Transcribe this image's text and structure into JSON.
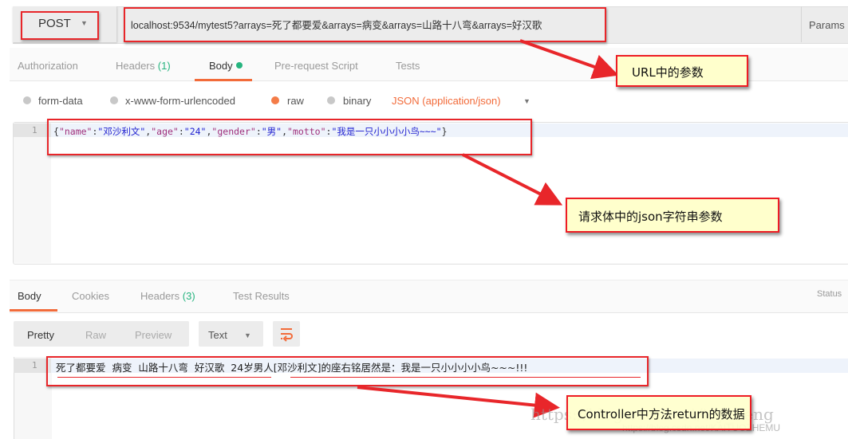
{
  "request": {
    "method": "POST",
    "url": "localhost:9534/mytest5?arrays=死了都要爱&arrays=病变&arrays=山路十八弯&arrays=好汉歌",
    "params_label": "Params",
    "tabs": [
      {
        "label": "Authorization"
      },
      {
        "label": "Headers",
        "count": "(1)"
      },
      {
        "label": "Body",
        "active": true
      },
      {
        "label": "Pre-request Script"
      },
      {
        "label": "Tests"
      }
    ],
    "body_types": [
      {
        "label": "form-data",
        "selected": false
      },
      {
        "label": "x-www-form-urlencoded",
        "selected": false
      },
      {
        "label": "raw",
        "selected": true
      },
      {
        "label": "binary",
        "selected": false
      }
    ],
    "content_type": "JSON (application/json)",
    "editor": {
      "line_number": "1",
      "tokens": {
        "open": "{",
        "k1": "\"name\"",
        "v1": "\"邓沙利文\"",
        "k2": "\"age\"",
        "v2": "\"24\"",
        "k3": "\"gender\"",
        "v3": "\"男\"",
        "k4": "\"motto\"",
        "v4": "\"我是一只小小小小鸟~~~\"",
        "close": "}",
        "colon": ":",
        "comma": ","
      }
    }
  },
  "response": {
    "tabs": [
      {
        "label": "Body",
        "active": true
      },
      {
        "label": "Cookies"
      },
      {
        "label": "Headers",
        "count": "(3)"
      },
      {
        "label": "Test Results"
      }
    ],
    "status_label": "Status",
    "view_modes": [
      "Pretty",
      "Raw",
      "Preview"
    ],
    "active_view": "Pretty",
    "format": "Text",
    "wrap_icon": "wrap-lines-icon",
    "line_number": "1",
    "body": "死了都要爱  病变  山路十八弯  好汉歌  24岁男人[邓沙利文]的座右铭居然是：我是一只小小小小鸟~~~!!!"
  },
  "annotations": {
    "url_callout": "URL中的参数",
    "body_callout": "请求体中的json字符串参数",
    "response_callout": "Controller中方法return的数据",
    "colors": {
      "red": "#e8262a",
      "callout_bg": "#ffffcc",
      "accent": "#f26b3a",
      "green": "#26b47f"
    }
  },
  "watermark": {
    "line1": "https://blog.csdn.net/try_deng",
    "line2": "https://blog.csdn.net/KAITUOZHEMU"
  }
}
